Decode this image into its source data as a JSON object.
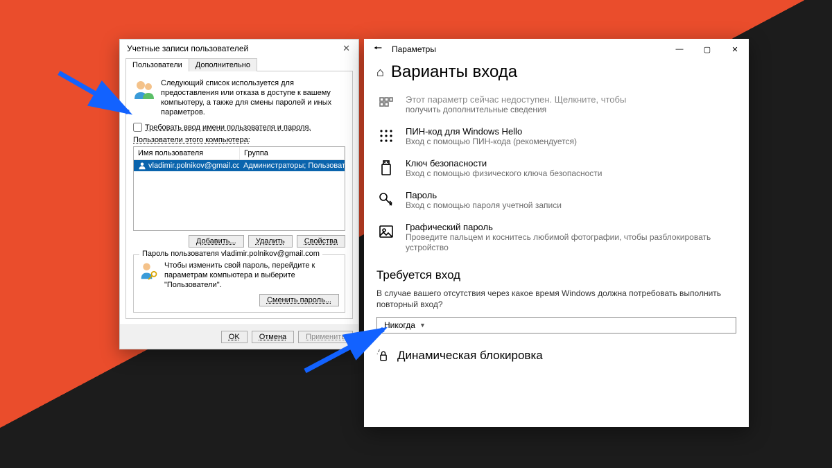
{
  "dialog": {
    "title": "Учетные записи пользователей",
    "tabs": {
      "users": "Пользователи",
      "advanced": "Дополнительно"
    },
    "intro": "Следующий список используется для предоставления или отказа в доступе к вашему компьютеру, а также для смены паролей и иных параметров.",
    "require_checkbox": "Требовать ввод имени пользователя и пароля.",
    "list_label": "Пользователи этого компьютера:",
    "columns": {
      "user": "Имя пользователя",
      "group": "Группа"
    },
    "row": {
      "user": "vladimir.polnikov@gmail.com",
      "group": "Администраторы; Пользоват..."
    },
    "buttons": {
      "add": "Добавить...",
      "remove": "Удалить",
      "props": "Свойства"
    },
    "pw_legend": "Пароль пользователя vladimir.polnikov@gmail.com",
    "pw_text": "Чтобы изменить свой пароль, перейдите к параметрам компьютера и выберите \"Пользователи\".",
    "pw_button": "Сменить пароль...",
    "footer": {
      "ok": "OK",
      "cancel": "Отмена",
      "apply": "Применить"
    }
  },
  "settings": {
    "app_title": "Параметры",
    "page_title": "Варианты входа",
    "top_hint": {
      "t": "Этот параметр сейчас недоступен. Щелкните, чтобы",
      "d": "получить дополнительные сведения"
    },
    "options": [
      {
        "icon": "keypad",
        "t": "ПИН-код для Windows Hello",
        "d": "Вход с помощью ПИН-кода (рекомендуется)"
      },
      {
        "icon": "usb",
        "t": "Ключ безопасности",
        "d": "Вход с помощью физического ключа безопасности"
      },
      {
        "icon": "key",
        "t": "Пароль",
        "d": "Вход с помощью пароля учетной записи"
      },
      {
        "icon": "picture",
        "t": "Графический пароль",
        "d": "Проведите пальцем и коснитесь любимой фотографии, чтобы разблокировать устройство"
      }
    ],
    "require_header": "Требуется вход",
    "require_text": "В случае вашего отсутствия через какое время Windows должна потребовать выполнить повторный вход?",
    "dropdown": "Никогда",
    "dynlock": "Динамическая блокировка"
  }
}
